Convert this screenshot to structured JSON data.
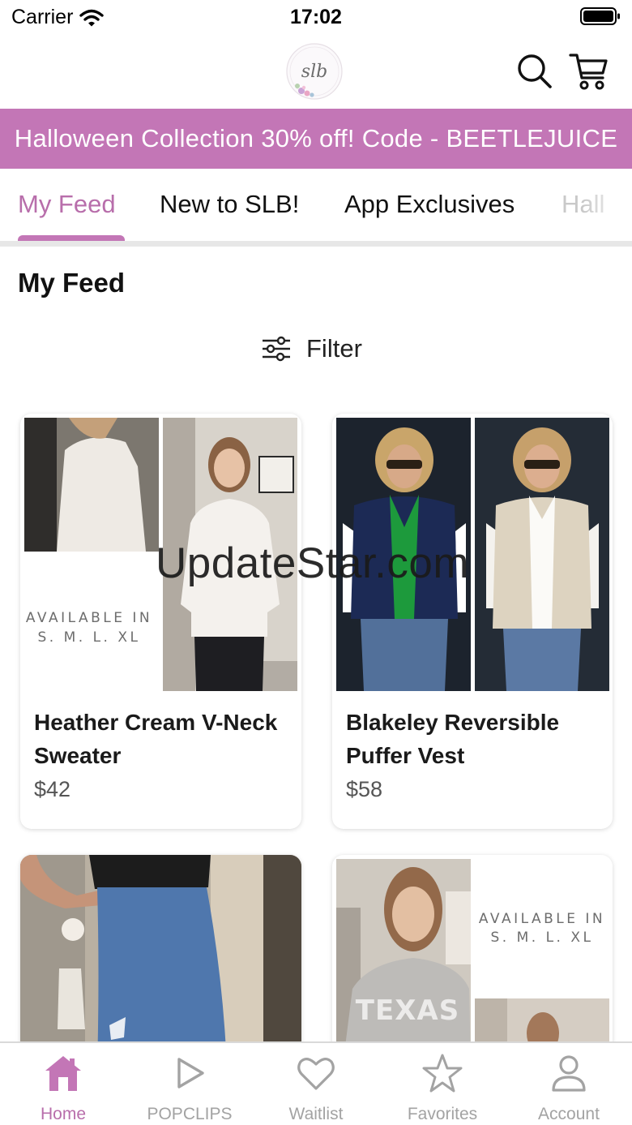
{
  "status_bar": {
    "carrier": "Carrier",
    "time": "17:02"
  },
  "header": {
    "logo_text": "slb"
  },
  "promo": {
    "text": "Halloween Collection 30% off! Code - BEETLEJUICE",
    "color": "#c376b6"
  },
  "tabs": [
    {
      "label": "My Feed",
      "active": true
    },
    {
      "label": "New to SLB!"
    },
    {
      "label": "App Exclusives"
    },
    {
      "label": "Hall"
    }
  ],
  "section": {
    "title": "My Feed",
    "filter_label": "Filter"
  },
  "products": [
    {
      "name": "Heather Cream V-Neck Sweater",
      "price": "$42"
    },
    {
      "name": "Blakeley Reversible Puffer Vest",
      "price": "$58"
    },
    {
      "name": "",
      "price": ""
    },
    {
      "name": "",
      "price": ""
    }
  ],
  "badges": {
    "available_line1": "AVAILABLE IN",
    "available_line2": "S. M. L. XL",
    "photo_text": "TEXAS"
  },
  "watermark": "UpdateStar.com",
  "bottom_nav": [
    {
      "label": "Home",
      "icon": "home-icon",
      "active": true
    },
    {
      "label": "POPCLIPS",
      "icon": "play-icon"
    },
    {
      "label": "Waitlist",
      "icon": "heart-icon"
    },
    {
      "label": "Favorites",
      "icon": "star-icon"
    },
    {
      "label": "Account",
      "icon": "person-icon"
    }
  ],
  "colors": {
    "accent": "#c376b6",
    "inactive": "#a3a3a3"
  }
}
